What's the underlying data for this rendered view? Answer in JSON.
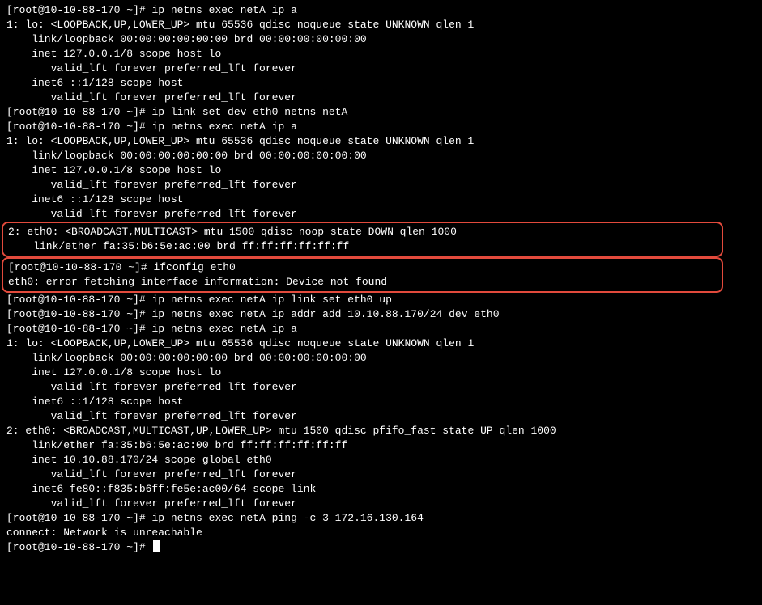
{
  "prompt": "[root@10-10-88-170 ~]# ",
  "blocks": [
    {
      "type": "cmd",
      "v": "ip netns exec netA ip a"
    },
    {
      "type": "out",
      "v": "1: lo: <LOOPBACK,UP,LOWER_UP> mtu 65536 qdisc noqueue state UNKNOWN qlen 1"
    },
    {
      "type": "out",
      "v": "    link/loopback 00:00:00:00:00:00 brd 00:00:00:00:00:00"
    },
    {
      "type": "out",
      "v": "    inet 127.0.0.1/8 scope host lo"
    },
    {
      "type": "out",
      "v": "       valid_lft forever preferred_lft forever"
    },
    {
      "type": "out",
      "v": "    inet6 ::1/128 scope host"
    },
    {
      "type": "out",
      "v": "       valid_lft forever preferred_lft forever"
    },
    {
      "type": "cmd",
      "v": "ip link set dev eth0 netns netA"
    },
    {
      "type": "cmd",
      "v": "ip netns exec netA ip a"
    },
    {
      "type": "out",
      "v": "1: lo: <LOOPBACK,UP,LOWER_UP> mtu 65536 qdisc noqueue state UNKNOWN qlen 1"
    },
    {
      "type": "out",
      "v": "    link/loopback 00:00:00:00:00:00 brd 00:00:00:00:00:00"
    },
    {
      "type": "out",
      "v": "    inet 127.0.0.1/8 scope host lo"
    },
    {
      "type": "out",
      "v": "       valid_lft forever preferred_lft forever"
    },
    {
      "type": "out",
      "v": "    inet6 ::1/128 scope host"
    },
    {
      "type": "out",
      "v": "       valid_lft forever preferred_lft forever"
    },
    {
      "type": "hl-start"
    },
    {
      "type": "out",
      "v": "2: eth0: <BROADCAST,MULTICAST> mtu 1500 qdisc noop state DOWN qlen 1000"
    },
    {
      "type": "out",
      "v": "    link/ether fa:35:b6:5e:ac:00 brd ff:ff:ff:ff:ff:ff"
    },
    {
      "type": "hl-split"
    },
    {
      "type": "cmd",
      "v": "ifconfig eth0"
    },
    {
      "type": "out",
      "v": "eth0: error fetching interface information: Device not found"
    },
    {
      "type": "hl-end"
    },
    {
      "type": "cmd",
      "v": "ip netns exec netA ip link set eth0 up"
    },
    {
      "type": "cmd",
      "v": "ip netns exec netA ip addr add 10.10.88.170/24 dev eth0"
    },
    {
      "type": "cmd",
      "v": "ip netns exec netA ip a"
    },
    {
      "type": "out",
      "v": "1: lo: <LOOPBACK,UP,LOWER_UP> mtu 65536 qdisc noqueue state UNKNOWN qlen 1"
    },
    {
      "type": "out",
      "v": "    link/loopback 00:00:00:00:00:00 brd 00:00:00:00:00:00"
    },
    {
      "type": "out",
      "v": "    inet 127.0.0.1/8 scope host lo"
    },
    {
      "type": "out",
      "v": "       valid_lft forever preferred_lft forever"
    },
    {
      "type": "out",
      "v": "    inet6 ::1/128 scope host"
    },
    {
      "type": "out",
      "v": "       valid_lft forever preferred_lft forever"
    },
    {
      "type": "out",
      "v": "2: eth0: <BROADCAST,MULTICAST,UP,LOWER_UP> mtu 1500 qdisc pfifo_fast state UP qlen 1000"
    },
    {
      "type": "out",
      "v": "    link/ether fa:35:b6:5e:ac:00 brd ff:ff:ff:ff:ff:ff"
    },
    {
      "type": "out",
      "v": "    inet 10.10.88.170/24 scope global eth0"
    },
    {
      "type": "out",
      "v": "       valid_lft forever preferred_lft forever"
    },
    {
      "type": "out",
      "v": "    inet6 fe80::f835:b6ff:fe5e:ac00/64 scope link"
    },
    {
      "type": "out",
      "v": "       valid_lft forever preferred_lft forever"
    },
    {
      "type": "cmd",
      "v": "ip netns exec netA ping -c 3 172.16.130.164"
    },
    {
      "type": "out",
      "v": "connect: Network is unreachable"
    },
    {
      "type": "cursor"
    }
  ]
}
